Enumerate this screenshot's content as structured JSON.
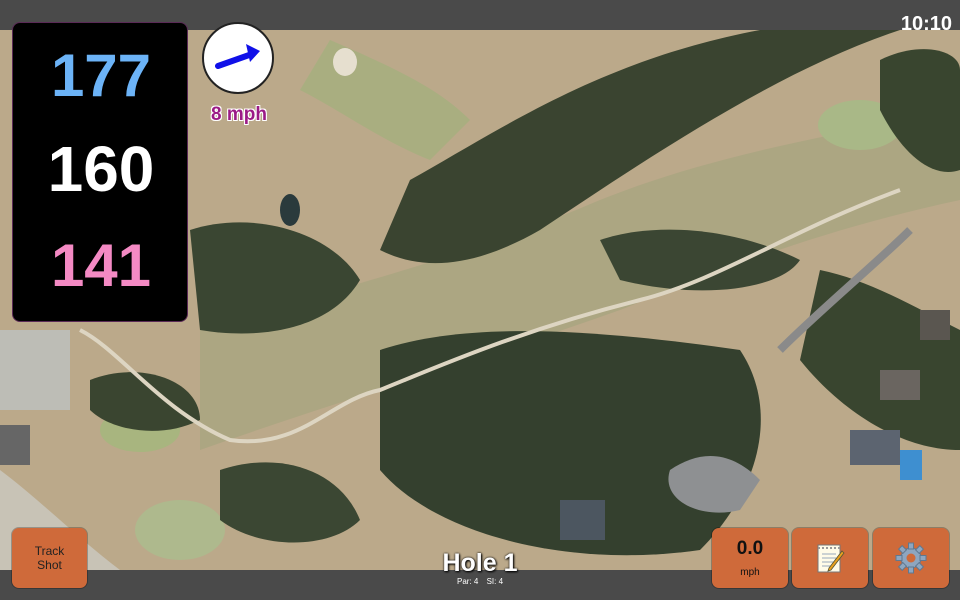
{
  "status_bar": {
    "time": "10:10"
  },
  "distances": {
    "back": "177",
    "middle": "160",
    "front": "141"
  },
  "wind": {
    "speed_label": "8 mph",
    "arrow_icon": "wind-direction-arrow"
  },
  "hole": {
    "title": "Hole 1",
    "par": "Par: 4",
    "si": "SI: 4"
  },
  "buttons": {
    "track_shot": {
      "line1": "Track",
      "line2": "Shot"
    },
    "speed": {
      "value": "0.0",
      "unit": "mph"
    },
    "notes_icon": "notepad-icon",
    "settings_icon": "gear-icon"
  },
  "colors": {
    "back": "#6cb3f7",
    "middle": "#ffffff",
    "front": "#f48ac4",
    "button": "#cf6a3a",
    "wind_label": "#9b1a86"
  }
}
